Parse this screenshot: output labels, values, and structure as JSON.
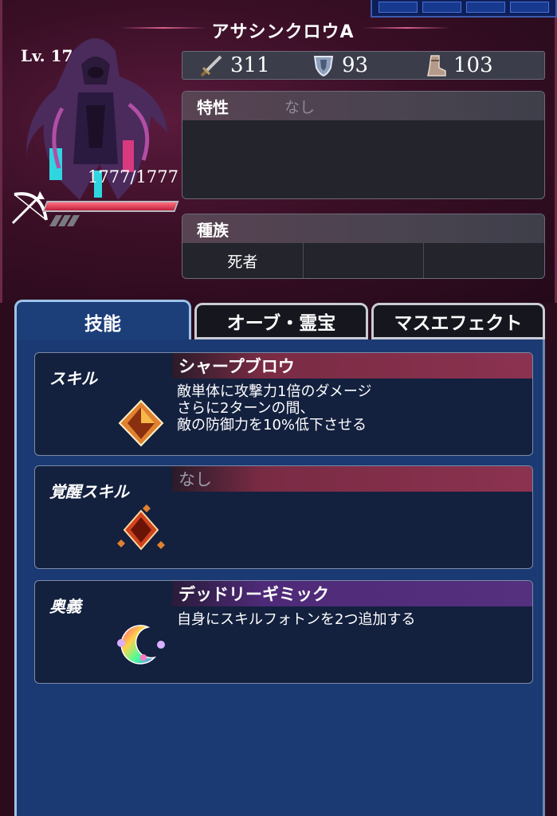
{
  "unit": {
    "name": "アサシンクロウA",
    "level": "Lv. 17",
    "hp": "1777/1777",
    "hp_fraction": 1.0
  },
  "stats": [
    {
      "icon": "sword-icon",
      "value": "311"
    },
    {
      "icon": "shield-icon",
      "value": "93"
    },
    {
      "icon": "boot-icon",
      "value": "103"
    }
  ],
  "traits": {
    "label": "特性",
    "value": "なし"
  },
  "race": {
    "label": "種族",
    "cells": [
      "死者",
      "",
      ""
    ]
  },
  "tabs": [
    {
      "label": "技能",
      "active": true
    },
    {
      "label": "オーブ・霊宝",
      "active": false
    },
    {
      "label": "マスエフェクト",
      "active": false
    }
  ],
  "skills": [
    {
      "label": "スキル",
      "title": "シャープブロウ",
      "desc": "敵単体に攻撃力1倍のダメージ\nさらに2ターンの間、\n敵の防御力を10%低下させる",
      "icon": "orange-crystal-icon"
    },
    {
      "label": "覚醒スキル",
      "title": "なし",
      "desc": "",
      "icon": "awakened-crystal-icon"
    },
    {
      "label": "奥義",
      "title": "デッドリーギミック",
      "desc": "自身にスキルフォトンを2つ追加する",
      "icon": "rainbow-crescent-icon"
    }
  ],
  "colors": {
    "accent_red": "#8b3250",
    "accent_purple": "#55307e",
    "panel_blue": "#1b3a73"
  }
}
